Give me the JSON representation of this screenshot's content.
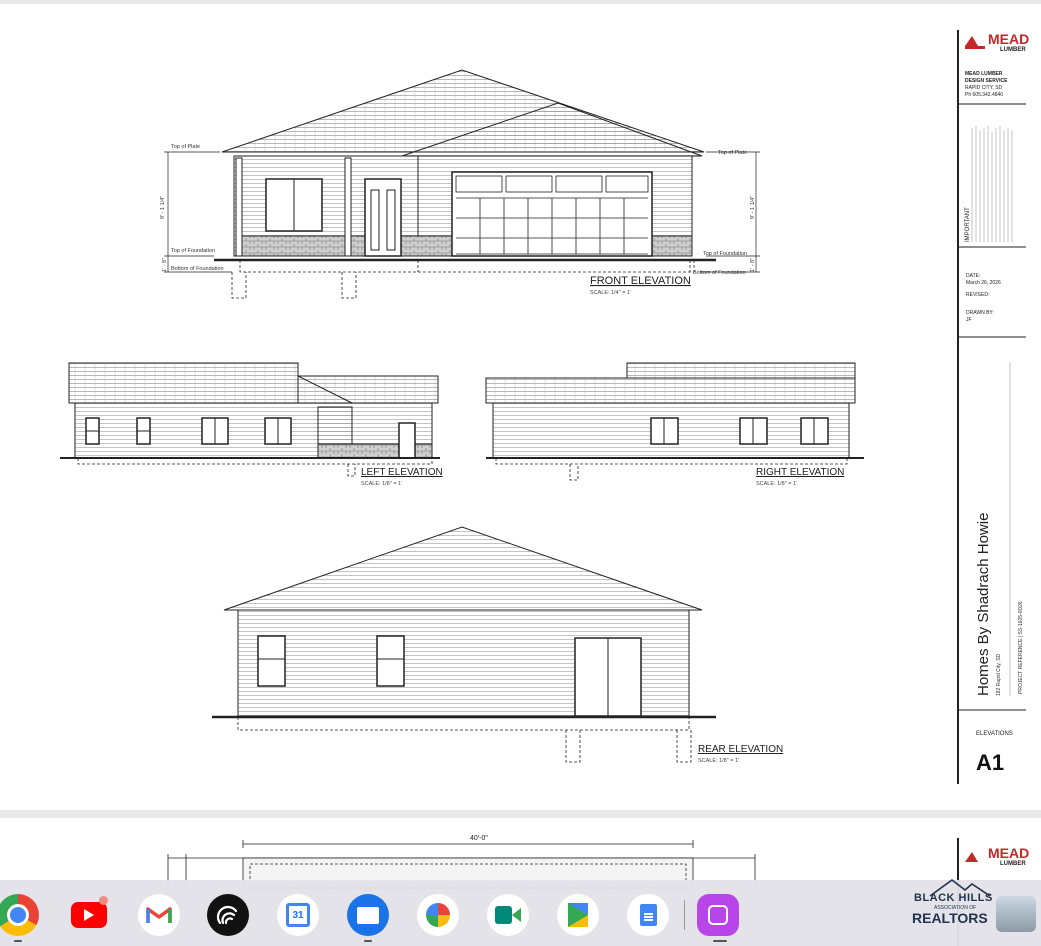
{
  "sheet": {
    "brand": {
      "name": "MEAD",
      "sub": "LUMBER"
    },
    "company": [
      "MEAD LUMBER",
      "DESIGN SERVICE",
      "RAPID CITY, SD",
      "Ph 605.342.4840"
    ],
    "important_label": "IMPORTANT",
    "date_label": "DATE:",
    "date_value": "March 26, 2026",
    "revised_label": "REVISED:",
    "drawn_label": "DRAWN BY:",
    "drawn_value": "JF",
    "project_title": "Homes By Shadrach Howie",
    "project_address": "182 Rapid City, SD",
    "project_ref": "PROJECT REFERENCE  |  SS-1605-0D26",
    "sheet_label": "ELEVATIONS",
    "sheet_number": "A1"
  },
  "views": {
    "front": {
      "title": "FRONT ELEVATION",
      "scale": "SCALE: 1/4\" = 1'"
    },
    "left": {
      "title": "LEFT ELEVATION",
      "scale": "SCALE: 1/8\" = 1'"
    },
    "right": {
      "title": "RIGHT ELEVATION",
      "scale": "SCALE: 1/8\" = 1'"
    },
    "rear": {
      "title": "REAR ELEVATION",
      "scale": "SCALE: 1/8\" = 1'"
    }
  },
  "front_notes": {
    "top_plate_left": "Top of Plate",
    "top_plate_right": "Top of Plate",
    "top_found_left": "Top of Foundation",
    "top_found_right": "Top of Foundation",
    "bottom_found_left": "Bottom of Foundation",
    "bottom_found_right": "Bottom of Foundation",
    "wall_height": "9' - 1 1/4\"",
    "found_height": "1' - 8\""
  },
  "page2": {
    "dimension": "40'-0\""
  },
  "taskbar": {
    "apps": [
      {
        "name": "Chrome",
        "icon": "chrome-icon"
      },
      {
        "name": "YouTube",
        "icon": "youtube-icon"
      },
      {
        "name": "Gmail",
        "icon": "gmail-icon"
      },
      {
        "name": "Signal",
        "icon": "signal-icon"
      },
      {
        "name": "Calendar",
        "icon": "calendar-icon",
        "text": "31"
      },
      {
        "name": "Files",
        "icon": "files-icon"
      },
      {
        "name": "Photos",
        "icon": "photos-icon"
      },
      {
        "name": "Meet",
        "icon": "meet-icon"
      },
      {
        "name": "Play Store",
        "icon": "play-store-icon"
      },
      {
        "name": "Docs",
        "icon": "docs-icon"
      },
      {
        "name": "Gallery",
        "icon": "gallery-icon"
      }
    ]
  },
  "watermark": {
    "line1": "BLACK HILLS",
    "line2": "ASSOCIATION OF",
    "line3": "REALTORS"
  },
  "colors": {
    "line": "#222222",
    "stone": "#9a9a9a",
    "youtube": "#ff0000",
    "gallery": "#b845e8",
    "files": "#1a73e8"
  }
}
